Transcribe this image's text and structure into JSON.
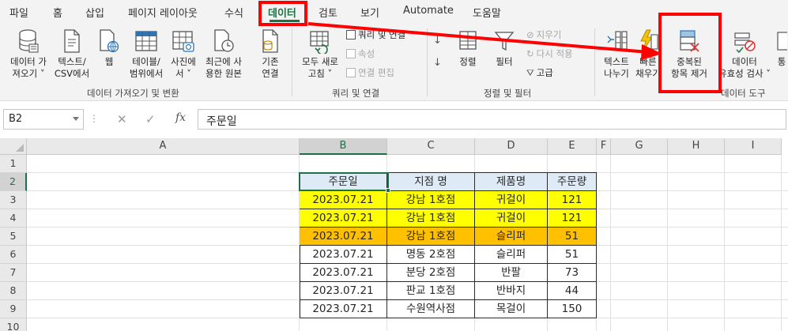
{
  "tabs": [
    {
      "label": "파일"
    },
    {
      "label": "홈"
    },
    {
      "label": "삽입"
    },
    {
      "label": "페이지 레이아웃"
    },
    {
      "label": "수식"
    },
    {
      "label": "데이터"
    },
    {
      "label": "검토"
    },
    {
      "label": "보기"
    },
    {
      "label": "Automate"
    },
    {
      "label": "도움말"
    }
  ],
  "ribbon": {
    "get_data": {
      "line1": "데이터 가",
      "line2": "져오기 ˅"
    },
    "from_text_csv": {
      "line1": "텍스트/",
      "line2": "CSV에서"
    },
    "from_web": {
      "line1": "웹"
    },
    "from_table_range": {
      "line1": "테이블/",
      "line2": "범위에서"
    },
    "from_picture": {
      "line1": "사진에",
      "line2": "서 ˅"
    },
    "recent_sources": {
      "line1": "최근에 사",
      "line2": "용한 원본"
    },
    "existing_connections": {
      "line1": "기존",
      "line2": "연결"
    },
    "refresh_all": {
      "line1": "모두 새로",
      "line2": "고침 ˅"
    },
    "queries_connections": "쿼리 및 연결",
    "properties": "속성",
    "edit_links": "연결 편집",
    "sort": "정렬",
    "filter": "필터",
    "clear": "지우기",
    "reapply": "다시 적용",
    "advanced": "고급",
    "text_to_columns": {
      "line1": "텍스트",
      "line2": "나누기"
    },
    "flash_fill": {
      "line1": "빠른",
      "line2": "채우기"
    },
    "remove_duplicates": {
      "line1": "중복된",
      "line2": "항목 제거"
    },
    "data_validation": {
      "line1": "데이터",
      "line2": "유효성 검사 ˅"
    },
    "more": {
      "line1": "통"
    },
    "groups": {
      "get_transform": "데이터 가져오기 및 변환",
      "queries": "쿼리 및 연결",
      "sort_filter": "정렬 및 필터",
      "data_tools": "데이터 도구"
    }
  },
  "formula_bar": {
    "name_box": "B2",
    "formula": "주문일",
    "fx": "fx"
  },
  "sheet": {
    "columns": [
      "A",
      "B",
      "C",
      "D",
      "E",
      "F",
      "G",
      "H",
      "I"
    ],
    "rows": [
      "1",
      "2",
      "3",
      "4",
      "5",
      "6",
      "7",
      "8",
      "9",
      "10"
    ],
    "table_header": [
      "주문일",
      "지점 명",
      "제품명",
      "주문량"
    ],
    "table_rows": [
      {
        "fill": "yellow",
        "cells": [
          "2023.07.21",
          "강남 1호점",
          "귀걸이",
          "121"
        ]
      },
      {
        "fill": "yellow",
        "cells": [
          "2023.07.21",
          "강남 1호점",
          "귀걸이",
          "121"
        ]
      },
      {
        "fill": "orange",
        "cells": [
          "2023.07.21",
          "강남 1호점",
          "슬리퍼",
          "51"
        ]
      },
      {
        "fill": "none",
        "cells": [
          "2023.07.21",
          "명동 2호점",
          "슬리퍼",
          "51"
        ]
      },
      {
        "fill": "none",
        "cells": [
          "2023.07.21",
          "분당 2호점",
          "반팔",
          "73"
        ]
      },
      {
        "fill": "none",
        "cells": [
          "2023.07.21",
          "판교 1호점",
          "반바지",
          "44"
        ]
      },
      {
        "fill": "none",
        "cells": [
          "2023.07.21",
          "수원역사점",
          "목걸이",
          "150"
        ]
      }
    ]
  },
  "colors": {
    "accent": "#1e7145",
    "highlight_red": "#ff0000",
    "duplicate_yellow": "#ffff00",
    "orange": "#ffc000",
    "header_blue": "#deebf7"
  },
  "icons": {
    "get_data": "database-icon",
    "text_csv": "text-file-icon",
    "web": "web-globe-icon",
    "table": "table-icon",
    "picture": "picture-table-icon",
    "recent": "recent-clock-icon",
    "connections": "connection-file-icon",
    "refresh": "refresh-icon",
    "sort": "sort-icon",
    "filter": "funnel-icon",
    "remove_duplicates": "remove-duplicates-icon",
    "data_validation": "validation-icon"
  }
}
